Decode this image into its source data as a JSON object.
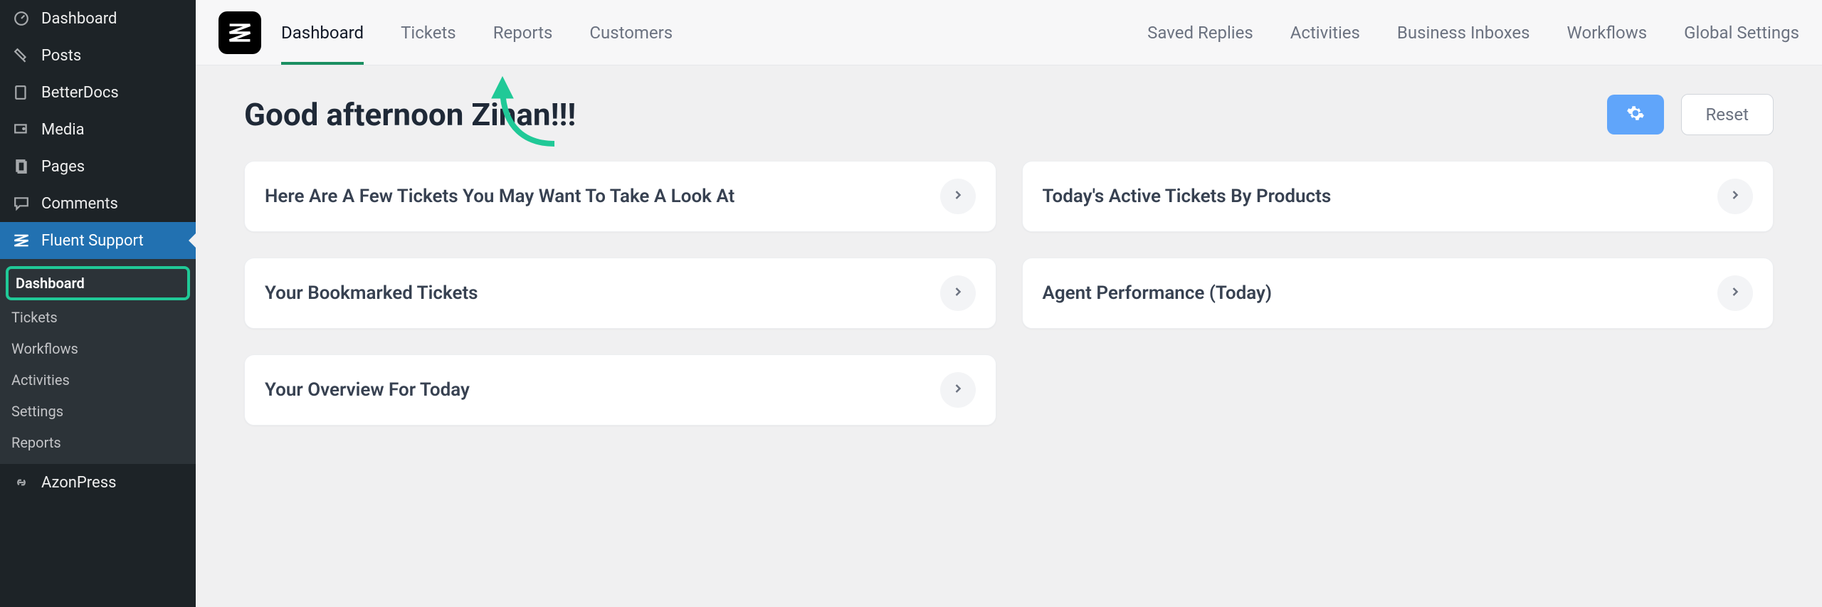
{
  "sidebar": {
    "items": [
      {
        "label": "Dashboard",
        "icon": "dashboard-icon"
      },
      {
        "label": "Posts",
        "icon": "pin-icon"
      },
      {
        "label": "BetterDocs",
        "icon": "docs-icon"
      },
      {
        "label": "Media",
        "icon": "media-icon"
      },
      {
        "label": "Pages",
        "icon": "pages-icon"
      },
      {
        "label": "Comments",
        "icon": "comments-icon"
      },
      {
        "label": "Fluent Support",
        "icon": "fluent-icon"
      },
      {
        "label": "AzonPress",
        "icon": "link-icon"
      }
    ],
    "submenu": [
      {
        "label": "Dashboard"
      },
      {
        "label": "Tickets"
      },
      {
        "label": "Workflows"
      },
      {
        "label": "Activities"
      },
      {
        "label": "Settings"
      },
      {
        "label": "Reports"
      }
    ]
  },
  "topnav": {
    "tabs": [
      {
        "label": "Dashboard"
      },
      {
        "label": "Tickets"
      },
      {
        "label": "Reports"
      },
      {
        "label": "Customers"
      }
    ],
    "links": [
      {
        "label": "Saved Replies"
      },
      {
        "label": "Activities"
      },
      {
        "label": "Business Inboxes"
      },
      {
        "label": "Workflows"
      },
      {
        "label": "Global Settings"
      }
    ]
  },
  "header": {
    "greeting": "Good afternoon Zinan!!!",
    "reset_label": "Reset"
  },
  "widgets": [
    {
      "title": "Here Are A Few Tickets You May Want To Take A Look At"
    },
    {
      "title": "Today's Active Tickets By Products"
    },
    {
      "title": "Your Bookmarked Tickets"
    },
    {
      "title": "Agent Performance (Today)"
    },
    {
      "title": "Your Overview For Today"
    }
  ],
  "colors": {
    "accent_green": "#20c997",
    "accent_blue": "#60a5fa"
  }
}
